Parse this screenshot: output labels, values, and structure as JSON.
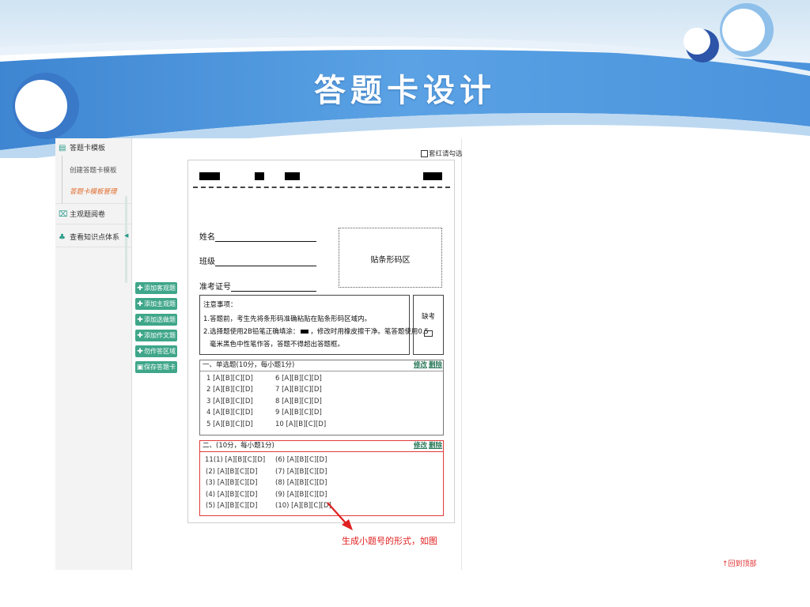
{
  "slide": {
    "title": "答题卡设计",
    "annotation": "生成小题号的形式，如图",
    "back_to_top": "↑回到顶部"
  },
  "colors": {
    "banner_blue": "#5a9ee0",
    "accent_green": "#3fa68a",
    "highlight_red": "#e03a3a",
    "active_orange": "#e06a2a"
  },
  "sidebar": {
    "items": [
      {
        "label": "答题卡模板",
        "icon": "document-icon"
      },
      {
        "label": "主观题阅卷",
        "icon": "grading-icon"
      },
      {
        "label": "查看知识点体系",
        "icon": "hierarchy-icon"
      }
    ],
    "subitems": [
      {
        "label": "创建答题卡模板",
        "active": false
      },
      {
        "label": "答题卡模板管理",
        "active": true
      }
    ]
  },
  "actions": [
    {
      "label": "添加客观题",
      "icon": "plus-icon"
    },
    {
      "label": "添加主观题",
      "icon": "plus-icon"
    },
    {
      "label": "添加选做题",
      "icon": "plus-icon"
    },
    {
      "label": "添加作文题",
      "icon": "plus-icon"
    },
    {
      "label": "勿作答区域",
      "icon": "plus-icon"
    },
    {
      "label": "保存答题卡",
      "icon": "save-icon"
    }
  ],
  "card": {
    "red_check_label": "套红请勾选",
    "fields": {
      "name": "姓名",
      "class": "班级",
      "exam_id": "准考证号"
    },
    "barcode_area": "贴条形码区",
    "notice": {
      "title": "注意事项：",
      "line1": "1.答题前，考生先将条形码准确粘贴在贴条形码区域内。",
      "line2a": "2.选择题使用2B铅笔正确填涂：",
      "line2b": "，修改时用橡皮擦干净。笔答题使用0.5",
      "line3": "毫米黑色中性笔作答，答题不得超出答题框。"
    },
    "absent": "缺考",
    "section1": {
      "title": "一、单选题(10分，每小题1分)",
      "edit": "修改",
      "delete": "删除",
      "col1": [
        "1 [A][B][C][D]",
        "2 [A][B][C][D]",
        "3 [A][B][C][D]",
        "4 [A][B][C][D]",
        "5 [A][B][C][D]"
      ],
      "col2": [
        "6 [A][B][C][D]",
        "7 [A][B][C][D]",
        "8 [A][B][C][D]",
        "9 [A][B][C][D]",
        "10 [A][B][C][D]"
      ]
    },
    "section2": {
      "title": "二、(10分，每小题1分)",
      "edit": "修改",
      "delete": "删除",
      "col1": [
        "11(1) [A][B][C][D]",
        "(2) [A][B][C][D]",
        "(3) [A][B][C][D]",
        "(4) [A][B][C][D]",
        "(5) [A][B][C][D]"
      ],
      "col2": [
        "(6) [A][B][C][D]",
        "(7) [A][B][C][D]",
        "(8) [A][B][C][D]",
        "(9) [A][B][C][D]",
        "(10) [A][B][C][D]"
      ]
    }
  }
}
